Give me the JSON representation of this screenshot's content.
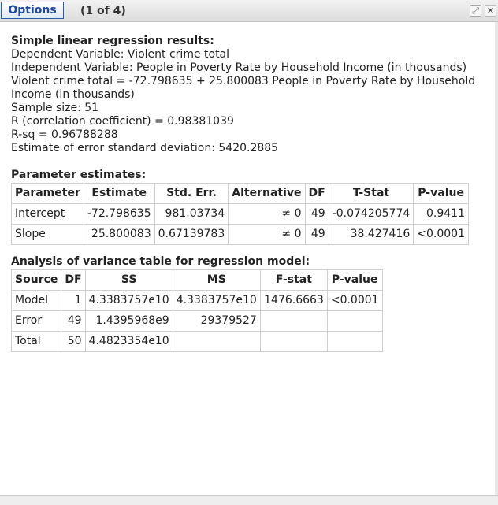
{
  "window": {
    "options_label": "Options",
    "page_indicator": "(1 of 4)",
    "expand_icon": "expand-icon",
    "close_icon": "close-icon"
  },
  "regression": {
    "title": "Simple linear regression results:",
    "dependent": "Dependent Variable: Violent crime total",
    "independent": "Independent Variable: People in Poverty Rate by Household Income (in thousands)",
    "equation": "Violent crime total = -72.798635 + 25.800083 People in Poverty Rate by Household Income (in thousands)",
    "sample_size": "Sample size: 51",
    "r": "R (correlation coefficient) = 0.98381039",
    "r_sq": "R-sq = 0.96788288",
    "error_sd": "Estimate of error standard deviation: 5420.2885"
  },
  "params": {
    "title": "Parameter estimates:",
    "headers": [
      "Parameter",
      "Estimate",
      "Std. Err.",
      "Alternative",
      "DF",
      "T-Stat",
      "P-value"
    ],
    "rows": [
      [
        "Intercept",
        "-72.798635",
        "981.03734",
        "≠ 0",
        "49",
        "-0.074205774",
        "0.9411"
      ],
      [
        "Slope",
        "25.800083",
        "0.67139783",
        "≠ 0",
        "49",
        "38.427416",
        "<0.0001"
      ]
    ]
  },
  "anova": {
    "title": "Analysis of variance table for regression model:",
    "headers": [
      "Source",
      "DF",
      "SS",
      "MS",
      "F-stat",
      "P-value"
    ],
    "rows": [
      [
        "Model",
        "1",
        "4.3383757e10",
        "4.3383757e10",
        "1476.6663",
        "<0.0001"
      ],
      [
        "Error",
        "49",
        "1.4395968e9",
        "29379527",
        "",
        ""
      ],
      [
        "Total",
        "50",
        "4.4823354e10",
        "",
        "",
        ""
      ]
    ]
  }
}
